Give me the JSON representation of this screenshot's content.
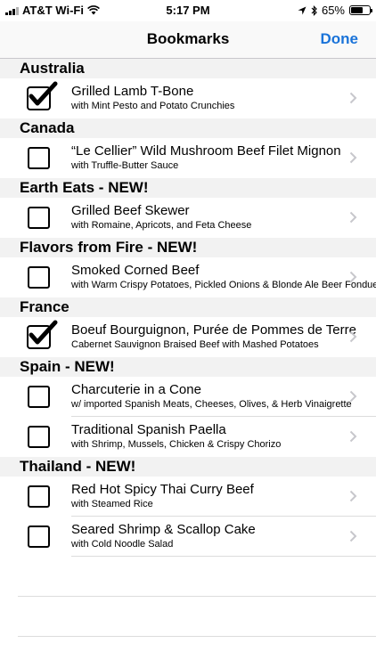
{
  "status": {
    "carrier": "AT&T Wi-Fi",
    "time": "5:17 PM",
    "battery_percent": "65%",
    "battery_level": 0.65
  },
  "nav": {
    "title": "Bookmarks",
    "done_label": "Done"
  },
  "accent_color": "#1a73d9",
  "sections": [
    {
      "header": "Australia",
      "items": [
        {
          "title": "Grilled Lamb T-Bone",
          "subtitle": "with Mint Pesto and Potato Crunchies",
          "checked": true
        }
      ]
    },
    {
      "header": "Canada",
      "items": [
        {
          "title": "“Le Cellier” Wild Mushroom Beef Filet Mignon",
          "subtitle": "with Truffle-Butter Sauce",
          "checked": false
        }
      ]
    },
    {
      "header": "Earth Eats - NEW!",
      "items": [
        {
          "title": "Grilled Beef Skewer",
          "subtitle": "with Romaine, Apricots, and Feta Cheese",
          "checked": false
        }
      ]
    },
    {
      "header": "Flavors from Fire - NEW!",
      "items": [
        {
          "title": "Smoked Corned Beef",
          "subtitle": "with Warm Crispy Potatoes, Pickled Onions & Blonde Ale Beer Fondue",
          "checked": false
        }
      ]
    },
    {
      "header": "France",
      "items": [
        {
          "title": "Boeuf Bourguignon, Purée de Pommes de Terre",
          "subtitle": "Cabernet Sauvignon Braised Beef with Mashed Potatoes",
          "checked": true
        }
      ]
    },
    {
      "header": "Spain - NEW!",
      "items": [
        {
          "title": "Charcuterie in a Cone",
          "subtitle": "w/ imported Spanish Meats, Cheeses, Olives, & Herb Vinaigrette",
          "checked": false
        },
        {
          "title": "Traditional Spanish Paella",
          "subtitle": "with Shrimp, Mussels, Chicken & Crispy Chorizo",
          "checked": false
        }
      ]
    },
    {
      "header": "Thailand - NEW!",
      "items": [
        {
          "title": "Red Hot Spicy Thai Curry Beef",
          "subtitle": "with Steamed Rice",
          "checked": false
        },
        {
          "title": "Seared Shrimp & Scallop Cake",
          "subtitle": "with Cold Noodle Salad",
          "checked": false
        }
      ]
    }
  ]
}
